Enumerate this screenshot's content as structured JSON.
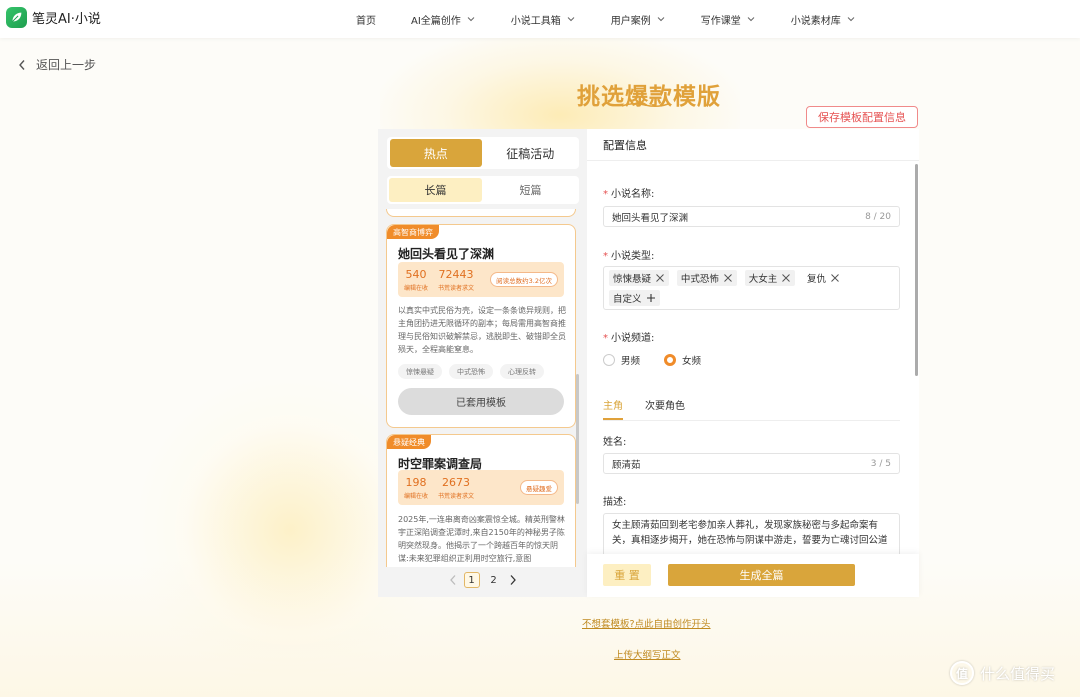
{
  "brand": {
    "name": "笔灵AI·小说"
  },
  "nav": {
    "items": [
      {
        "label": "首页",
        "has_dropdown": false
      },
      {
        "label": "AI全篇创作",
        "has_dropdown": true
      },
      {
        "label": "小说工具箱",
        "has_dropdown": true
      },
      {
        "label": "用户案例",
        "has_dropdown": true
      },
      {
        "label": "写作课堂",
        "has_dropdown": true
      },
      {
        "label": "小说素材库",
        "has_dropdown": true
      }
    ]
  },
  "back": {
    "label": "返回上一步"
  },
  "page": {
    "title": "挑选爆款模版",
    "save_label": "保存模板配置信息"
  },
  "left": {
    "tabs": [
      {
        "label": "热点",
        "active": true
      },
      {
        "label": "征稿活动",
        "active": false
      }
    ],
    "subtabs": [
      {
        "label": "长篇",
        "active": true
      },
      {
        "label": "短篇",
        "active": false
      }
    ],
    "cards": [
      {
        "tag": "高智商博弈",
        "title": "她回头看见了深渊",
        "stat1_num": "540",
        "stat1_label": "编辑在收",
        "stat2_num": "72443",
        "stat2_label": "书荒读者求文",
        "badge": "阅读总数约3.2亿次",
        "desc": "以真实中式民俗为壳，设定一条条诡异规则，把主角团扔进无限循环的副本；每局需用高智商推理与民俗知识破解禁忌，逃脱即生、破错即全员殒天，全程高能窒息。",
        "tags": [
          "惊悚悬疑",
          "中式恐怖",
          "心理反转"
        ],
        "button": "已套用模板"
      },
      {
        "tag": "悬疑经典",
        "title": "时空罪案调查局",
        "stat1_num": "198",
        "stat1_label": "编辑在收",
        "stat2_num": "2673",
        "stat2_label": "书荒读者求文",
        "badge": "悬疑趣爱",
        "desc": "2025年,一连串离奇凶案震惊全城。精英刑警林宇正深陷调查泥潭时,来自2150年的神秘男子陈明突然现身。他揭示了一个跨越百年的惊天阴谋:未来犯罪组织正利用时空旅行,意图"
      }
    ],
    "pagination": {
      "pages": [
        "1",
        "2"
      ],
      "current": "1"
    }
  },
  "right": {
    "header": "配置信息",
    "novel_name": {
      "label": "小说名称:",
      "value": "她回头看见了深渊",
      "count": "8 / 20"
    },
    "novel_type": {
      "label": "小说类型:",
      "chips": [
        "惊悚悬疑",
        "中式恐怖",
        "大女主",
        "复仇"
      ],
      "custom": "自定义"
    },
    "channel": {
      "label": "小说频道:",
      "options": [
        {
          "label": "男频",
          "selected": false
        },
        {
          "label": "女频",
          "selected": true
        }
      ]
    },
    "char_tabs": [
      {
        "label": "主角",
        "active": true
      },
      {
        "label": "次要角色",
        "active": false
      }
    ],
    "name": {
      "label": "姓名:",
      "value": "顾清茹",
      "count": "3 / 5"
    },
    "desc": {
      "label": "描述:",
      "value": "女主顾清茹回到老宅参加亲人葬礼，发现家族秘密与多起命案有关，真相逐步揭开，她在恐怖与阴谋中游走，誓要为亡魂讨回公道"
    },
    "reset_label": "重 置",
    "generate_label": "生成全篇"
  },
  "links": {
    "free_create": "不想套模板?点此自由创作开头",
    "upload_outline": "上传大纲写正文"
  },
  "watermark": {
    "text": "什么值得买",
    "symbol": "值"
  },
  "colors": {
    "accent": "#d9a53b",
    "accent_light": "#fdefc2",
    "orange": "#f08c2a",
    "danger": "#e65353"
  }
}
